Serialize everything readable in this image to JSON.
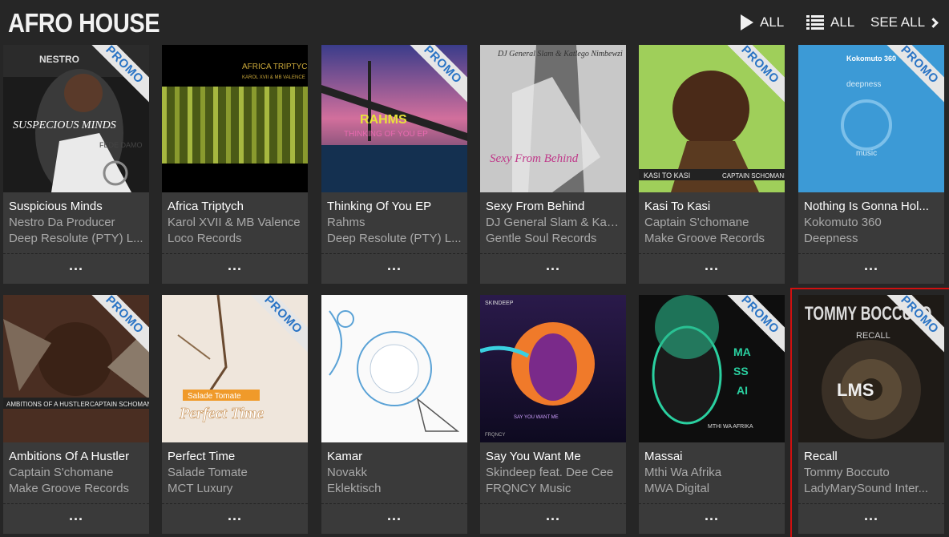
{
  "header": {
    "title": "AFRO HOUSE",
    "play_all_label": "ALL",
    "list_all_label": "ALL",
    "see_all_label": "SEE ALL"
  },
  "colors": {
    "promo_text": "#2a74c5",
    "card_bg": "#3a3a3a",
    "page_bg": "#262626",
    "selection": "#d01010"
  },
  "promo_label": "PROMO",
  "more_label": "...",
  "releases": [
    {
      "title": "Suspicious Minds",
      "artist": "Nestro Da Producer",
      "label": "Deep Resolute (PTY) L...",
      "promo": true,
      "art_text": "SUSPECIOUS MINDS",
      "art_top": "NESTRO",
      "art_sub": "FEDE DAMO"
    },
    {
      "title": "Africa Triptych",
      "artist": "Karol XVII & MB Valence",
      "label": "Loco Records",
      "promo": false,
      "art_text": "AFRICA TRIPTYCH",
      "art_sub": "KAROL XVII & MB VALENCE"
    },
    {
      "title": "Thinking Of You EP",
      "artist": "Rahms",
      "label": "Deep Resolute (PTY) L...",
      "promo": true,
      "art_text": "RAHMS",
      "art_sub": "THINKING OF YOU EP"
    },
    {
      "title": "Sexy From Behind",
      "artist": "DJ General Slam & Katl...",
      "label": "Gentle Soul Records",
      "promo": false,
      "art_text": "Sexy From Behind",
      "art_top": "DJ General Slam & Katlego Nimbewzi"
    },
    {
      "title": "Kasi To Kasi",
      "artist": "Captain S'chomane",
      "label": "Make Groove Records",
      "promo": true,
      "art_text": "KASI TO KASI",
      "art_sub": "CAPTAIN SCHOMANE"
    },
    {
      "title": "Nothing Is Gonna Hol...",
      "artist": "Kokomuto 360",
      "label": "Deepness",
      "promo": true,
      "art_text": "deepness",
      "art_top": "Kokomuto 360",
      "art_sub": "music"
    },
    {
      "title": "Ambitions Of A Hustler",
      "artist": "Captain S'chomane",
      "label": "Make Groove Records",
      "promo": true,
      "art_text": "AMBITIONS OF A HUSTLER",
      "art_sub": "CAPTAIN SCHOMANE"
    },
    {
      "title": "Perfect Time",
      "artist": "Salade Tomate",
      "label": "MCT Luxury",
      "promo": true,
      "art_text": "Perfect Time",
      "art_sub": "Salade Tomate"
    },
    {
      "title": "Kamar",
      "artist": "Novakk",
      "label": "Eklektisch",
      "promo": false,
      "art_text": ""
    },
    {
      "title": "Say You Want Me",
      "artist": "Skindeep feat. Dee Cee",
      "label": "FRQNCY Music",
      "promo": false,
      "art_text": "SAY YOU WANT ME",
      "art_top": "SKINDEEP",
      "art_sub": "FRQNCY"
    },
    {
      "title": "Massai",
      "artist": "Mthi Wa Afrika",
      "label": "MWA Digital",
      "promo": true,
      "art_text": "MA SS AI",
      "art_sub": "MTHI WA AFRIKA"
    },
    {
      "title": "Recall",
      "artist": "Tommy Boccuto",
      "label": "LadyMarySound Inter...",
      "promo": true,
      "art_text": "LMS",
      "art_top": "TOMMY BOCCUTO",
      "art_sub": "RECALL"
    }
  ]
}
